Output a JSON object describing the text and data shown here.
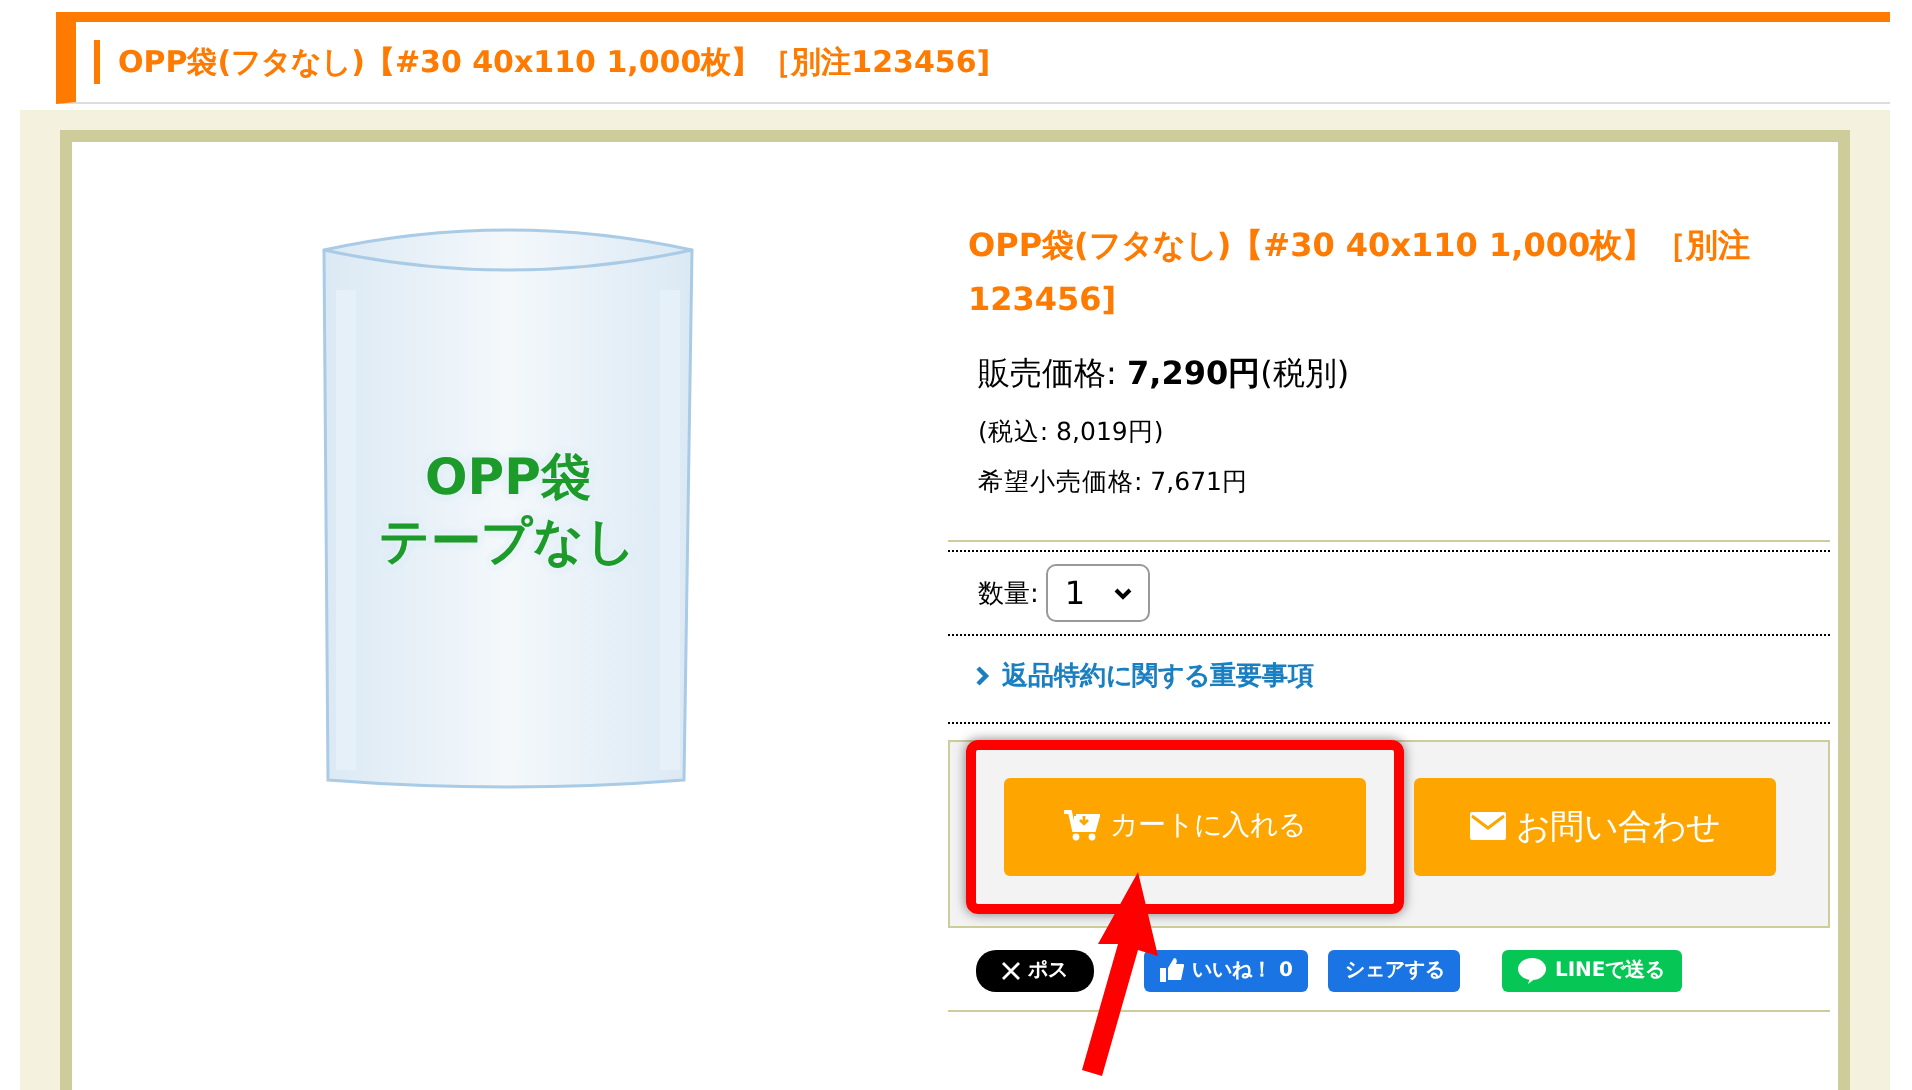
{
  "page_title": "OPP袋(フタなし)【#30 40x110 1,000枚】［別注123456]",
  "product_image": {
    "kind": "picture",
    "label_lines": [
      "OPP袋",
      "テープなし"
    ]
  },
  "product": {
    "title": "OPP袋(フタなし)【#30 40x110 1,000枚】［別注123456]",
    "price_label": "販売価格:",
    "price": "7,290円",
    "price_note": "(税別)",
    "tax_included": "(税込: 8,019円)",
    "retail_price": "希望小売価格: 7,671円",
    "quantity_label": "数量:",
    "quantity": "1",
    "returns_link": "返品特約に関する重要事項"
  },
  "buttons": [
    {
      "kind": "cart",
      "label": "カートに入れる",
      "highlighted": true
    },
    {
      "kind": "mail",
      "label": "お問い合わせ",
      "highlighted": false
    }
  ],
  "social": [
    {
      "kind": "x",
      "label": "ポス"
    },
    {
      "kind": "like",
      "label": "いいね！ 0"
    },
    {
      "kind": "share",
      "label": "シェアする"
    },
    {
      "kind": "line",
      "label": "LINEで送る"
    }
  ]
}
